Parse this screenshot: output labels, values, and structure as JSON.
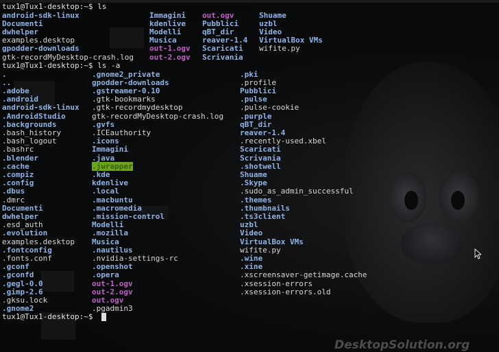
{
  "terminal": {
    "cmd1": {
      "prompt": "tux1@Tux1-desktop:~$ ",
      "command": "ls"
    },
    "ls_output": {
      "col1": [
        {
          "name": "android-sdk-linux",
          "kind": "dir"
        },
        {
          "name": "Documenti",
          "kind": "dir"
        },
        {
          "name": "dwhelper",
          "kind": "dir"
        },
        {
          "name": "examples.desktop",
          "kind": "file"
        },
        {
          "name": "gpodder-downloads",
          "kind": "dir"
        },
        {
          "name": "gtk-recordMyDesktop-crash.log",
          "kind": "file"
        }
      ],
      "col2": [
        {
          "name": "Immagini",
          "kind": "dir"
        },
        {
          "name": "kdenlive",
          "kind": "dir"
        },
        {
          "name": "Modelli",
          "kind": "dir"
        },
        {
          "name": "Musica",
          "kind": "dir"
        },
        {
          "name": "out-1.ogv",
          "kind": "media"
        },
        {
          "name": "out-2.ogv",
          "kind": "media"
        }
      ],
      "col3": [
        {
          "name": "out.ogv",
          "kind": "media"
        },
        {
          "name": "Pubblici",
          "kind": "dir"
        },
        {
          "name": "qBT_dir",
          "kind": "dir"
        },
        {
          "name": "reaver-1.4",
          "kind": "dir"
        },
        {
          "name": "Scaricati",
          "kind": "dir"
        },
        {
          "name": "Scrivania",
          "kind": "dir"
        }
      ],
      "col4": [
        {
          "name": "Shuame",
          "kind": "dir"
        },
        {
          "name": "uzbl",
          "kind": "dir"
        },
        {
          "name": "Video",
          "kind": "dir"
        },
        {
          "name": "VirtualBox VMs",
          "kind": "dir"
        },
        {
          "name": "wifite.py",
          "kind": "file"
        }
      ]
    },
    "cmd2": {
      "prompt": "tux1@Tux1-desktop:~$ ",
      "command": "ls -a"
    },
    "ls_a_output": {
      "col1": [
        {
          "name": ".",
          "kind": "dir"
        },
        {
          "name": "..",
          "kind": "dir"
        },
        {
          "name": ".adobe",
          "kind": "dir"
        },
        {
          "name": ".android",
          "kind": "dir"
        },
        {
          "name": "android-sdk-linux",
          "kind": "dir"
        },
        {
          "name": ".AndroidStudio",
          "kind": "dir"
        },
        {
          "name": ".backgrounds",
          "kind": "dir"
        },
        {
          "name": ".bash_history",
          "kind": "file"
        },
        {
          "name": ".bash_logout",
          "kind": "file"
        },
        {
          "name": ".bashrc",
          "kind": "file"
        },
        {
          "name": ".blender",
          "kind": "dir"
        },
        {
          "name": ".cache",
          "kind": "dir"
        },
        {
          "name": ".compiz",
          "kind": "dir"
        },
        {
          "name": ".config",
          "kind": "dir"
        },
        {
          "name": ".dbus",
          "kind": "dir"
        },
        {
          "name": ".dmrc",
          "kind": "file"
        },
        {
          "name": "Documenti",
          "kind": "dir"
        },
        {
          "name": "dwhelper",
          "kind": "dir"
        },
        {
          "name": ".esd_auth",
          "kind": "file"
        },
        {
          "name": ".evolution",
          "kind": "dir"
        },
        {
          "name": "examples.desktop",
          "kind": "file"
        },
        {
          "name": ".fontconfig",
          "kind": "dir"
        },
        {
          "name": ".fonts.conf",
          "kind": "file"
        },
        {
          "name": ".gconf",
          "kind": "dir"
        },
        {
          "name": ".gconfd",
          "kind": "dir"
        },
        {
          "name": ".gegl-0.0",
          "kind": "dir"
        },
        {
          "name": ".gimp-2.6",
          "kind": "dir"
        },
        {
          "name": ".gksu.lock",
          "kind": "file"
        },
        {
          "name": ".gnome2",
          "kind": "dir"
        }
      ],
      "col2": [
        {
          "name": ".gnome2_private",
          "kind": "dir"
        },
        {
          "name": "gpodder-downloads",
          "kind": "dir"
        },
        {
          "name": ".gstreamer-0.10",
          "kind": "dir"
        },
        {
          "name": ".gtk-bookmarks",
          "kind": "file"
        },
        {
          "name": ".gtk-recordmydesktop",
          "kind": "file"
        },
        {
          "name": "gtk-recordMyDesktop-crash.log",
          "kind": "file"
        },
        {
          "name": ".gvfs",
          "kind": "dir"
        },
        {
          "name": ".ICEauthority",
          "kind": "file"
        },
        {
          "name": ".icons",
          "kind": "dir"
        },
        {
          "name": "Immagini",
          "kind": "dir"
        },
        {
          "name": ".java",
          "kind": "dir"
        },
        {
          "name": ".jwrapper",
          "kind": "highlight"
        },
        {
          "name": ".kde",
          "kind": "dir"
        },
        {
          "name": "kdenlive",
          "kind": "dir"
        },
        {
          "name": ".local",
          "kind": "dir"
        },
        {
          "name": ".macbuntu",
          "kind": "dir"
        },
        {
          "name": ".macromedia",
          "kind": "dir"
        },
        {
          "name": ".mission-control",
          "kind": "dir"
        },
        {
          "name": "Modelli",
          "kind": "dir"
        },
        {
          "name": ".mozilla",
          "kind": "dir"
        },
        {
          "name": "Musica",
          "kind": "dir"
        },
        {
          "name": ".nautilus",
          "kind": "dir"
        },
        {
          "name": ".nvidia-settings-rc",
          "kind": "file"
        },
        {
          "name": ".openshot",
          "kind": "dir"
        },
        {
          "name": ".opera",
          "kind": "dir"
        },
        {
          "name": "out-1.ogv",
          "kind": "media"
        },
        {
          "name": "out-2.ogv",
          "kind": "media"
        },
        {
          "name": "out.ogv",
          "kind": "media"
        },
        {
          "name": ".pgadmin3",
          "kind": "file"
        }
      ],
      "col3": [
        {
          "name": ".pki",
          "kind": "dir"
        },
        {
          "name": ".profile",
          "kind": "file"
        },
        {
          "name": "Pubblici",
          "kind": "dir"
        },
        {
          "name": ".pulse",
          "kind": "dir"
        },
        {
          "name": ".pulse-cookie",
          "kind": "file"
        },
        {
          "name": ".purple",
          "kind": "dir"
        },
        {
          "name": "qBT_dir",
          "kind": "dir"
        },
        {
          "name": "reaver-1.4",
          "kind": "dir"
        },
        {
          "name": ".recently-used.xbel",
          "kind": "file"
        },
        {
          "name": "Scaricati",
          "kind": "dir"
        },
        {
          "name": "Scrivania",
          "kind": "dir"
        },
        {
          "name": ".shotwell",
          "kind": "dir"
        },
        {
          "name": "Shuame",
          "kind": "dir"
        },
        {
          "name": ".Skype",
          "kind": "dir"
        },
        {
          "name": ".sudo_as_admin_successful",
          "kind": "file"
        },
        {
          "name": ".themes",
          "kind": "dir"
        },
        {
          "name": ".thumbnails",
          "kind": "dir"
        },
        {
          "name": ".ts3client",
          "kind": "dir"
        },
        {
          "name": "uzbl",
          "kind": "dir"
        },
        {
          "name": "Video",
          "kind": "dir"
        },
        {
          "name": "VirtualBox VMs",
          "kind": "dir"
        },
        {
          "name": "wifite.py",
          "kind": "file"
        },
        {
          "name": ".wine",
          "kind": "dir"
        },
        {
          "name": ".xine",
          "kind": "dir"
        },
        {
          "name": ".xscreensaver-getimage.cache",
          "kind": "file"
        },
        {
          "name": ".xsession-errors",
          "kind": "file"
        },
        {
          "name": ".xsession-errors.old",
          "kind": "file"
        }
      ]
    },
    "cmd3": {
      "prompt": "tux1@Tux1-desktop:~$ ",
      "command": ""
    }
  },
  "watermark": "DesktopSolution.org",
  "colors": {
    "background": "#070808",
    "directory": "#8fb3e6",
    "media": "#c25fc8",
    "plain": "#d8d8d6",
    "highlight_bg": "#6ba51f",
    "highlight_fg": "#3b5f0b"
  },
  "icons": {
    "mouse_pointer": "arrow-cursor-icon"
  }
}
